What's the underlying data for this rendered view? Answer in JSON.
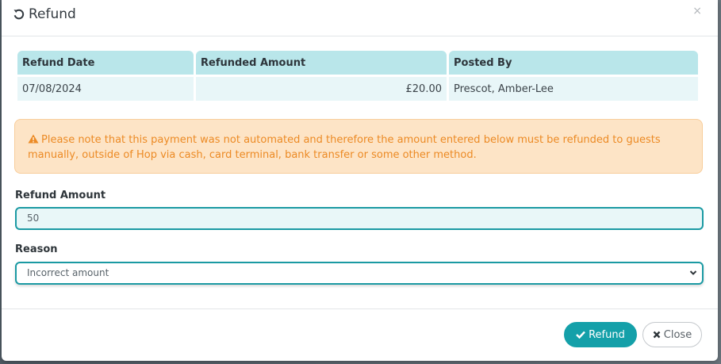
{
  "dialog": {
    "title": "Refund",
    "close_symbol": "×",
    "icons": {
      "title_icon": "undo-icon",
      "close_icon": "close-icon"
    }
  },
  "refunds_table": {
    "headers": [
      "Refund Date",
      "Refunded Amount",
      "Posted By"
    ],
    "rows": [
      {
        "date": "07/08/2024",
        "amount": "£20.00",
        "posted_by": "Prescot, Amber-Lee"
      }
    ]
  },
  "alert": {
    "icon": "warning-icon",
    "text": "Please note that this payment was not automated and therefore the amount entered below must be refunded to guests manually, outside of Hop via cash, card terminal, bank transfer or some other method."
  },
  "form": {
    "refund_amount": {
      "label": "Refund Amount",
      "value": "50"
    },
    "reason": {
      "label": "Reason",
      "selected": "Incorrect amount"
    }
  },
  "buttons": {
    "refund_label": "Refund",
    "close_label": "Close"
  },
  "colors": {
    "accent": "#14a0a9",
    "table_header": "#b9e6ea",
    "alert_bg": "#fde4c6",
    "alert_text": "#ec8a24"
  }
}
